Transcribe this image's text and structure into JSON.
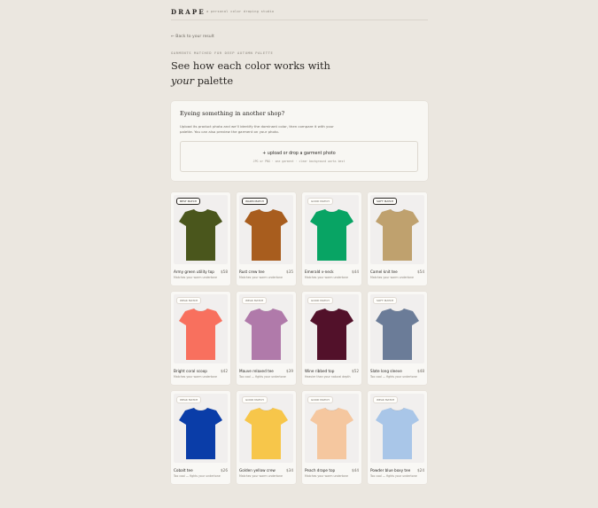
{
  "header": {
    "brand": "DRAPE",
    "tagline": "a personal color draping studio"
  },
  "nav": {
    "back_label": "← Back to your result"
  },
  "intro": {
    "eyebrow": "GARMENTS MATCHED FOR DEEP AUTUMN PALETTE",
    "title_prefix": "See how each color works with ",
    "title_emphasis": "your",
    "title_suffix": " palette"
  },
  "upload": {
    "heading": "Eyeing something in another shop?",
    "description": "Upload its product photo and we'll identify the dominant color, then compare it with your palette. You can also preview the garment on your photo.",
    "dropzone_label": "+ upload or drop a garment photo",
    "dropzone_hint": "JPG or PNG · one garment · clear background works best"
  },
  "products": [
    {
      "name": "Army green utility top",
      "price": "$58",
      "note": "Matches your warm undertone",
      "badge": "BEST MATCH",
      "badge_style": "strong",
      "color": "#4a561c"
    },
    {
      "name": "Rust crew tee",
      "price": "$35",
      "note": "Matches your warm undertone",
      "badge": "WARM MATCH",
      "badge_style": "strong",
      "color": "#a85d1e"
    },
    {
      "name": "Emerald v-neck",
      "price": "$44",
      "note": "Matches your warm undertone",
      "badge": "GOOD MATCH",
      "badge_style": "soft",
      "color": "#08a464"
    },
    {
      "name": "Camel knit tee",
      "price": "$54",
      "note": "Matches your warm undertone",
      "badge": "SOFT MATCH",
      "badge_style": "strong",
      "color": "#bfa16e"
    },
    {
      "name": "Bright coral scoop",
      "price": "$42",
      "note": "Matches your warm undertone",
      "badge": "WEAK MATCH",
      "badge_style": "soft",
      "color": "#f8705e"
    },
    {
      "name": "Mauve relaxed tee",
      "price": "$39",
      "note": "Too cool — fights your undertone",
      "badge": "WEAK MATCH",
      "badge_style": "soft",
      "color": "#b07aaa"
    },
    {
      "name": "Wine ribbed top",
      "price": "$52",
      "note": "Heavier than your natural depth",
      "badge": "GOOD MATCH",
      "badge_style": "soft",
      "color": "#52112a"
    },
    {
      "name": "Slate long sleeve",
      "price": "$48",
      "note": "Too cool — fights your undertone",
      "badge": "SOFT MATCH",
      "badge_style": "soft",
      "color": "#6b7c98"
    },
    {
      "name": "Cobalt tee",
      "price": "$26",
      "note": "Too cool — fights your undertone",
      "badge": "WEAK MATCH",
      "badge_style": "soft",
      "color": "#0a3da8"
    },
    {
      "name": "Golden yellow crew",
      "price": "$34",
      "note": "Matches your warm undertone",
      "badge": "GOOD MATCH",
      "badge_style": "soft",
      "color": "#f7c64a"
    },
    {
      "name": "Peach drape top",
      "price": "$44",
      "note": "Matches your warm undertone",
      "badge": "GOOD MATCH",
      "badge_style": "soft",
      "color": "#f5c79f"
    },
    {
      "name": "Powder blue boxy tee",
      "price": "$24",
      "note": "Too cool — fights your undertone",
      "badge": "WEAK MATCH",
      "badge_style": "soft",
      "color": "#a9c6e8"
    }
  ]
}
